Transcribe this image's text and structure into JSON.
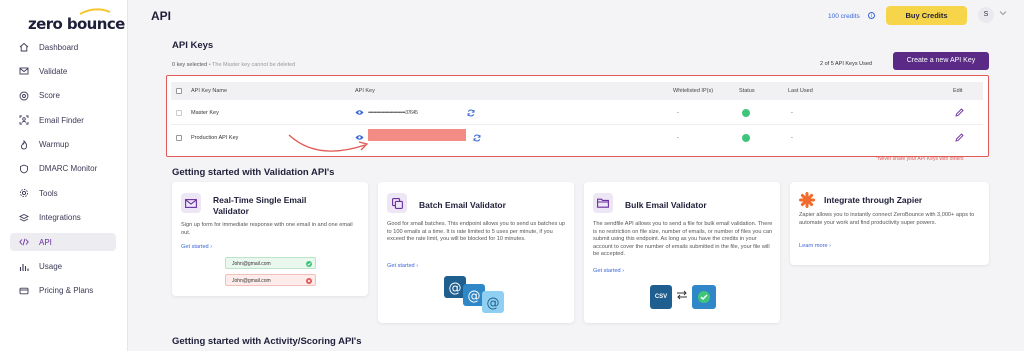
{
  "brand": {
    "logo_text": "zero bounce",
    "accent": "#5b2a86",
    "buy_color": "#f7d54a"
  },
  "sidebar": {
    "items": [
      {
        "label": "Dashboard",
        "icon": "home-icon"
      },
      {
        "label": "Validate",
        "icon": "mail-icon"
      },
      {
        "label": "Score",
        "icon": "target-icon"
      },
      {
        "label": "Email Finder",
        "icon": "person-search-icon"
      },
      {
        "label": "Warmup",
        "icon": "flame-icon"
      },
      {
        "label": "DMARC Monitor",
        "icon": "shield-icon"
      },
      {
        "label": "Tools",
        "icon": "gear-icon"
      },
      {
        "label": "Integrations",
        "icon": "layers-icon"
      },
      {
        "label": "API",
        "icon": "code-icon",
        "active": true
      },
      {
        "label": "Usage",
        "icon": "bar-chart-icon"
      },
      {
        "label": "Pricing & Plans",
        "icon": "card-icon"
      }
    ]
  },
  "header": {
    "title": "API",
    "credits": "100 credits",
    "credits_info": "i",
    "buy_label": "Buy Credits",
    "avatar_initial": "S"
  },
  "api_keys": {
    "title": "API Keys",
    "selected_text": "0 key selected",
    "master_note": " • The Master key cannot be deleted",
    "count_text": "2 of 5 API Keys Used",
    "create_label": "Create a new API Key",
    "columns": [
      "API Key Name",
      "API Key",
      "Whitelisted IP(s)",
      "Status",
      "Last Used",
      "Edit"
    ],
    "rows": [
      {
        "name": "Master Key",
        "key": "••••••••••••••••••••••••••••37645",
        "ips": "-",
        "last_used": "-"
      },
      {
        "name": "Production API Key",
        "key": "",
        "ips": "-",
        "last_used": "-"
      }
    ],
    "warning": "*Never share your API Keys with others"
  },
  "validation": {
    "title": "Getting started with Validation API's",
    "cards": [
      {
        "title": "Real-Time Single Email Validator",
        "desc": "Sign up form for immediate response with one email in and one email out.",
        "link": "Get started ›",
        "emails": [
          "John@gmail.com",
          "John@gmail.com"
        ]
      },
      {
        "title": "Batch Email Validator",
        "desc": "Good for small batches. This endpoint allows you to send us batches up to 100 emails at a time. It is rate limited to 5 uses per minute, if you exceed the rate limit, you will be blocked for 10 minutes.",
        "link": "Get started ›"
      },
      {
        "title": "Bulk Email Validator",
        "desc": "The sendfile API allows you to send a file for bulk email validation. There is no restriction on file size, number of emails, or number of files you can submit using this endpoint. As long as you have the credits in your account to cover the number of emails submitted in the file, your file will be accepted.",
        "link": "Get started ›",
        "csv_label": "CSV"
      },
      {
        "title": "Integrate through Zapier",
        "desc": "Zapier allows you to instantly connect ZeroBounce with 3,000+ apps to automate your work and find productivity super powers.",
        "link": "Learn more ›"
      }
    ]
  },
  "activity": {
    "title": "Getting started with Activity/Scoring API's"
  }
}
